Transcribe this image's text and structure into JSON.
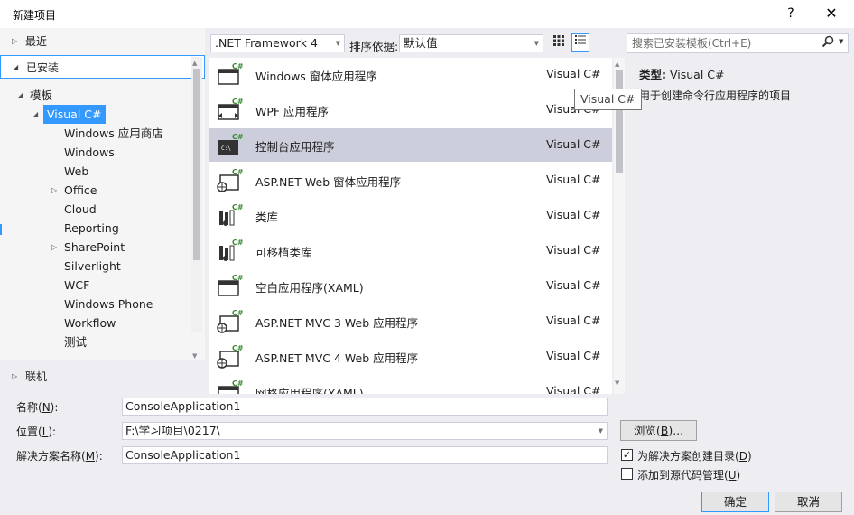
{
  "window": {
    "title": "新建项目",
    "help": "?",
    "close": "✕"
  },
  "left": {
    "recent": "最近",
    "installed": "已安装",
    "online": "联机",
    "tree": {
      "templates": "模板",
      "visual_cs": "Visual C#",
      "children": [
        "Windows 应用商店",
        "Windows",
        "Web",
        "Office",
        "Cloud",
        "Reporting",
        "SharePoint",
        "Silverlight",
        "WCF",
        "Windows Phone",
        "Workflow",
        "测试"
      ]
    }
  },
  "toolbar": {
    "framework": ".NET Framework 4",
    "sort_label": "排序依据:",
    "sort_value": "默认值"
  },
  "templates": [
    {
      "name": "Windows 窗体应用程序",
      "lang": "Visual C#",
      "icon": "winforms-icon"
    },
    {
      "name": "WPF 应用程序",
      "lang": "Visual C#",
      "icon": "wpf-icon"
    },
    {
      "name": "控制台应用程序",
      "lang": "Visual C#",
      "icon": "console-icon"
    },
    {
      "name": "ASP.NET Web 窗体应用程序",
      "lang": "Visual C#",
      "icon": "web-forms-icon"
    },
    {
      "name": "类库",
      "lang": "Visual C#",
      "icon": "class-library-icon"
    },
    {
      "name": "可移植类库",
      "lang": "Visual C#",
      "icon": "portable-library-icon"
    },
    {
      "name": "空白应用程序(XAML)",
      "lang": "Visual C#",
      "icon": "blank-app-icon"
    },
    {
      "name": "ASP.NET MVC 3 Web 应用程序",
      "lang": "Visual C#",
      "icon": "mvc3-icon"
    },
    {
      "name": "ASP.NET MVC 4 Web 应用程序",
      "lang": "Visual C#",
      "icon": "mvc4-icon"
    },
    {
      "name": "网格应用程序(XAML)",
      "lang": "Visual C#",
      "icon": "grid-app-icon"
    }
  ],
  "right": {
    "search_placeholder": "搜索已安装模板(Ctrl+E)",
    "type_label": "类型:",
    "type_value": "Visual C#",
    "description": "用于创建命令行应用程序的项目",
    "tooltip": "Visual C#"
  },
  "form": {
    "name_label": "名称(",
    "name_key": "N",
    "name_label_end": "):",
    "name_value": "ConsoleApplication1",
    "location_label": "位置(",
    "location_key": "L",
    "location_label_end": "):",
    "location_value": "F:\\学习项目\\0217\\",
    "solution_label": "解决方案名称(",
    "solution_key": "M",
    "solution_label_end": "):",
    "solution_value": "ConsoleApplication1",
    "browse_label": "浏览(",
    "browse_key": "B",
    "browse_label_end": ")...",
    "create_dir_label": "为解决方案创建目录(",
    "create_dir_key": "D",
    "create_dir_end": ")",
    "create_dir_checked": true,
    "source_control_label": "添加到源代码管理(",
    "source_control_key": "U",
    "source_control_end": ")",
    "source_control_checked": false,
    "ok": "确定",
    "cancel": "取消"
  },
  "colors": {
    "accent": "#3399ff",
    "selection": "#cccedb",
    "cs_green": "#388a34"
  }
}
